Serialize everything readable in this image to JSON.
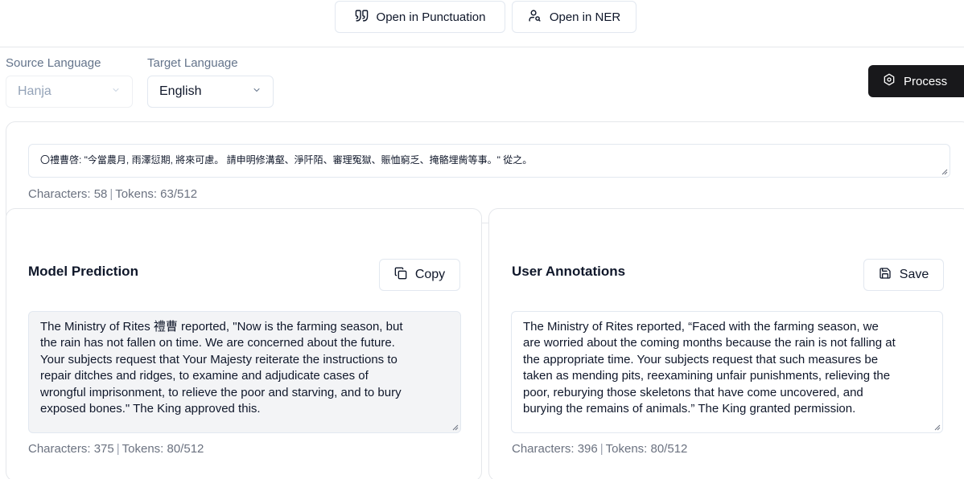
{
  "toolbar": {
    "punctuation_label": "Open in Punctuation",
    "ner_label": "Open in NER"
  },
  "languages": {
    "source_label": "Source Language",
    "source_value": "Hanja",
    "target_label": "Target Language",
    "target_value": "English"
  },
  "process_label": "Process",
  "source": {
    "text": "〇禮曹啓: \"今當農月, 雨澤愆期, 將來可慮。 請申明修溝壑、淨阡陌、審理冤獄、賑恤窮乏、掩骼埋胔等事。\" 從之。",
    "characters": "Characters: 58",
    "tokens": "Tokens: 63/512"
  },
  "prediction": {
    "title": "Model Prediction",
    "copy_label": "Copy",
    "lines": [
      "The Ministry of Rites 禮曹 reported, \"Now is the farming season, but",
      "the rain has not fallen on time. We are concerned about the future.",
      "Your subjects request that Your Majesty reiterate the instructions to",
      "repair ditches and ridges, to examine and adjudicate cases of",
      "wrongful imprisonment, to relieve the poor and starving, and to bury",
      "exposed bones.\" The King approved this."
    ],
    "characters": "Characters: 375",
    "tokens": "Tokens: 80/512"
  },
  "annotation": {
    "title": "User Annotations",
    "save_label": "Save",
    "lines": [
      "The Ministry of Rites reported, “Faced with the farming season, we",
      "are worried about the coming months because the rain is not falling at",
      "the appropriate time. Your subjects request that such measures be",
      "taken as mending pits, reexamining unfair punishments, relieving the",
      "poor, reburying those skeletons that have come uncovered, and",
      "burying the remains of animals.” The King granted permission."
    ],
    "characters": "Characters: 396",
    "tokens": "Tokens: 80/512"
  },
  "icons": {
    "punctuation": "quote-icon",
    "ner": "user-search-icon",
    "process": "settings-icon",
    "copy": "copy-icon",
    "save": "save-icon",
    "dropdown": "chevron-down-icon"
  }
}
